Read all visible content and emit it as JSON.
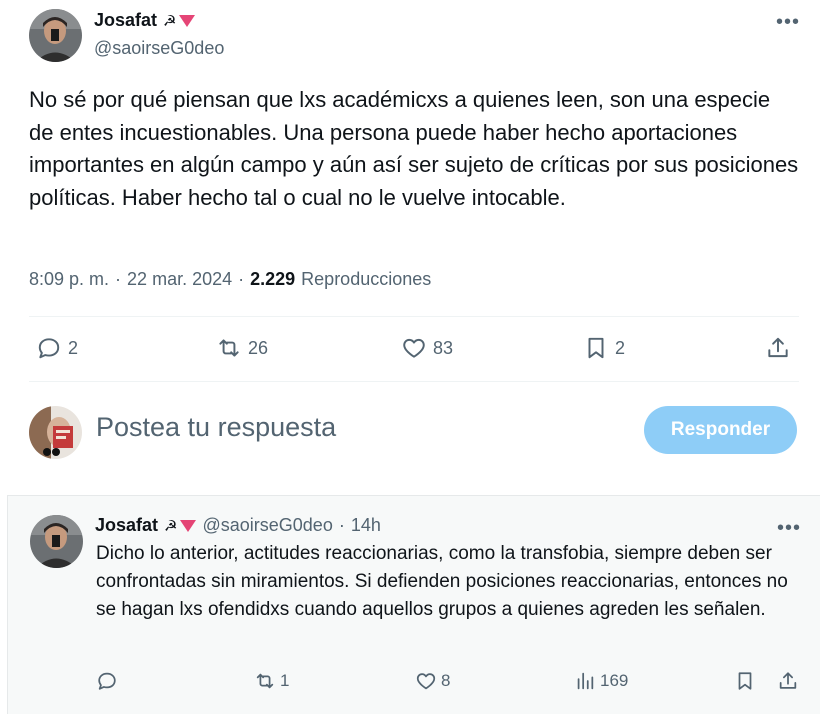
{
  "main_tweet": {
    "display_name": "Josafat",
    "emoji_sickle": "☭",
    "handle": "@saoirseG0deo",
    "more_label": "•••",
    "text": "No sé por qué piensan que lxs académicxs a quienes leen, son una especie de entes incuestionables. Una persona puede haber hecho aportaciones importantes en algún campo y aún así ser sujeto de críticas por sus posiciones políticas. Haber hecho tal o cual no le vuelve intocable.",
    "time": "8:09 p. m.",
    "sep1": "·",
    "date": "22 mar. 2024",
    "sep2": "·",
    "views_count": "2.229",
    "views_label": "Reproducciones",
    "actions": {
      "replies": "2",
      "retweets": "26",
      "likes": "83",
      "bookmarks": "2"
    }
  },
  "reply_composer": {
    "placeholder": "Postea tu respuesta",
    "button_label": "Responder"
  },
  "reply_tweet": {
    "display_name": "Josafat",
    "emoji_sickle": "☭",
    "handle": "@saoirseG0deo",
    "sep": "·",
    "time": "14h",
    "more_label": "•••",
    "text": "Dicho lo anterior, actitudes reaccionarias, como la transfobia, siempre deben ser confrontadas sin miramientos. Si defienden posiciones reaccionarias, entonces no se hagan lxs ofendidxs cuando aquellos grupos a quienes agreden les señalen.",
    "actions": {
      "replies": "",
      "retweets": "1",
      "likes": "8",
      "views": "169"
    }
  },
  "colors": {
    "accent_button": "#8ecdf7",
    "secondary_text": "#536471",
    "primary_text": "#0f1419",
    "flag_red": "#e0245e"
  }
}
